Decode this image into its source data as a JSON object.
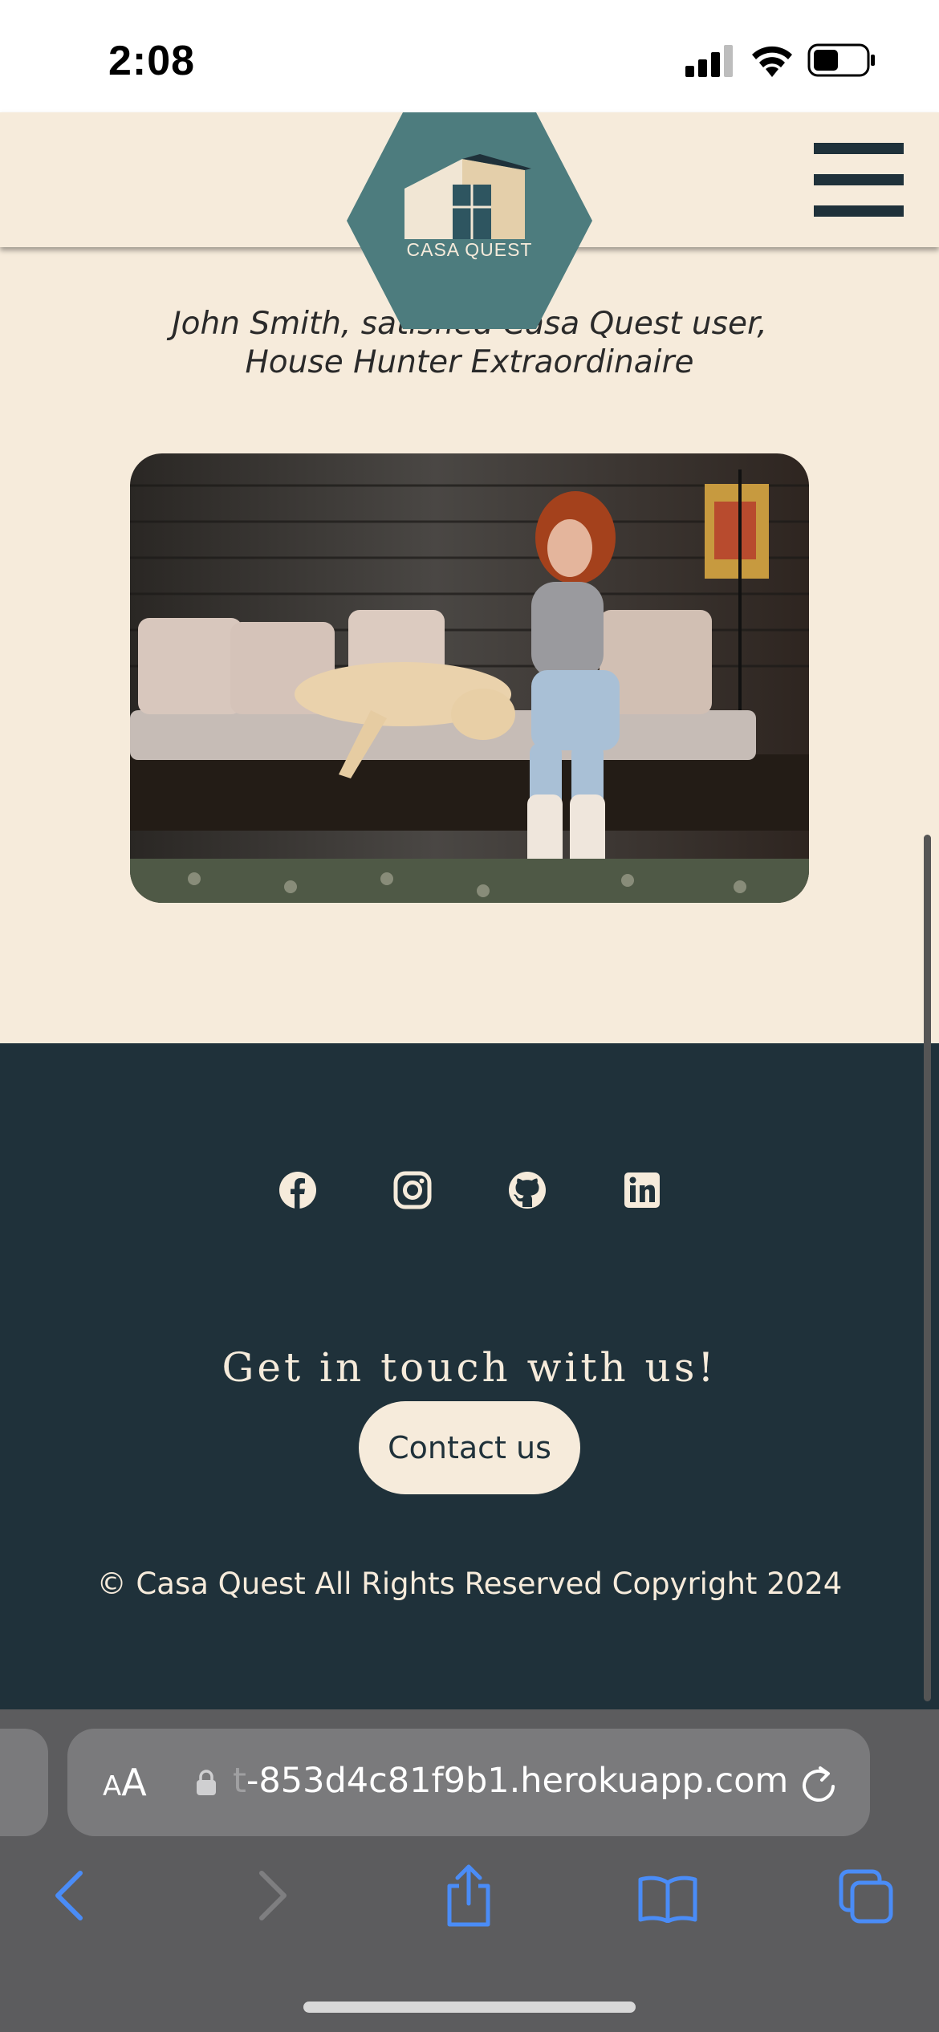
{
  "status_bar": {
    "time": "2:08",
    "icons": [
      "signal-icon",
      "wifi-icon",
      "battery-icon"
    ]
  },
  "header": {
    "logo_text": "CASA QUEST",
    "menu_icon": "hamburger-menu-icon",
    "colors": {
      "background": "#f6ebdb",
      "logo_teal": "#4d7c7e",
      "dark": "#1f313a"
    }
  },
  "testimonial": {
    "author_line1": "John Smith, satisfied Casa Quest user,",
    "author_line2": "House Hunter Extraordinaire",
    "photo_subject": "woman petting a dog on a sofa"
  },
  "footer": {
    "social_icons": [
      "facebook-icon",
      "instagram-icon",
      "github-icon",
      "linkedin-icon"
    ],
    "heading": "Get in touch with us!",
    "contact_button": "Contact us",
    "copyright": "© Casa Quest All Rights Reserved Copyright 2024",
    "colors": {
      "background": "#1f313a",
      "text": "#f6ebdb"
    }
  },
  "browser": {
    "text_size_small": "A",
    "text_size_large": "A",
    "url_faded_part": "t",
    "url": "-853d4c81f9b1.herokuapp.com",
    "toolbar_icons": [
      "back-icon",
      "forward-icon",
      "share-icon",
      "bookmarks-icon",
      "tabs-icon"
    ],
    "accent": "#4a8cf7"
  }
}
